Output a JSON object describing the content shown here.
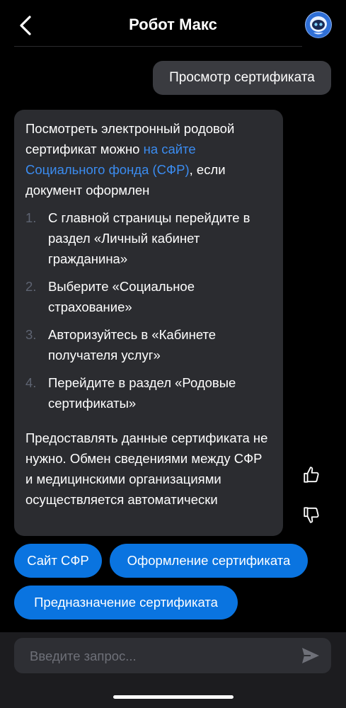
{
  "header": {
    "title": "Робот Макс",
    "back_icon": "chevron-left-icon",
    "avatar_icon": "robot-avatar"
  },
  "messages": {
    "user": "Просмотр сертификата",
    "bot": {
      "intro_before_link": "Посмотреть электронный родовой сертификат можно ",
      "link_text": "на сайте Социального фонда (СФР)",
      "intro_after_link": ", если документ оформлен",
      "steps": [
        {
          "num": "1.",
          "text": "С главной страницы перейдите в раздел «Личный кабинет гражданина»"
        },
        {
          "num": "2.",
          "text": "Выберите «Социальное страхование»"
        },
        {
          "num": "3.",
          "text": "Авторизуйтесь в «Кабинете получателя услуг»"
        },
        {
          "num": "4.",
          "text": "Перейдите в раздел «Родовые сертификаты»"
        }
      ],
      "closing": "Предоставлять данные сертификата не нужно. Обмен сведениями между СФР и медицинскими организациями осуществляется автоматически"
    }
  },
  "feedback": {
    "like_icon": "thumbs-up-icon",
    "dislike_icon": "thumbs-down-icon"
  },
  "quick_replies": [
    "Сайт СФР",
    "Оформление сертификата",
    "Предназначение сертификата"
  ],
  "input": {
    "value": "",
    "placeholder": "Введите запрос...",
    "send_icon": "send-icon"
  },
  "colors": {
    "background": "#000000",
    "bubble_bot": "#2b2c30",
    "bubble_user": "#3a3b40",
    "accent": "#0a74e0",
    "link": "#3b8cf0"
  }
}
